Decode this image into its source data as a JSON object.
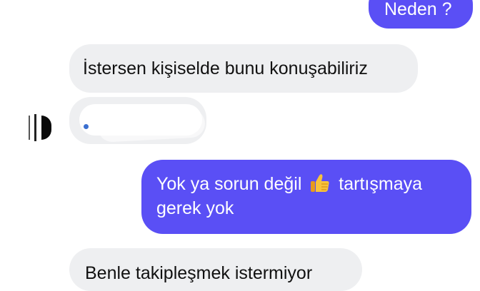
{
  "messages": [
    {
      "direction": "sent",
      "text": "Neden ?"
    },
    {
      "direction": "received",
      "text": "İstersen kişiselde bunu konuşabiliriz"
    },
    {
      "direction": "received",
      "text": ""
    },
    {
      "direction": "sent",
      "line1_before_emoji": "Yok ya sorun değil",
      "emoji": "thumbs-up-icon",
      "line1_after_emoji": "tartışmaya",
      "line2": "gerek yok"
    },
    {
      "direction": "received",
      "text": "Benle takipleşmek istermiyor"
    }
  ],
  "colors": {
    "sent_bubble": "#5a4ff5",
    "received_bubble": "#eeeff1",
    "background": "#ffffff"
  }
}
